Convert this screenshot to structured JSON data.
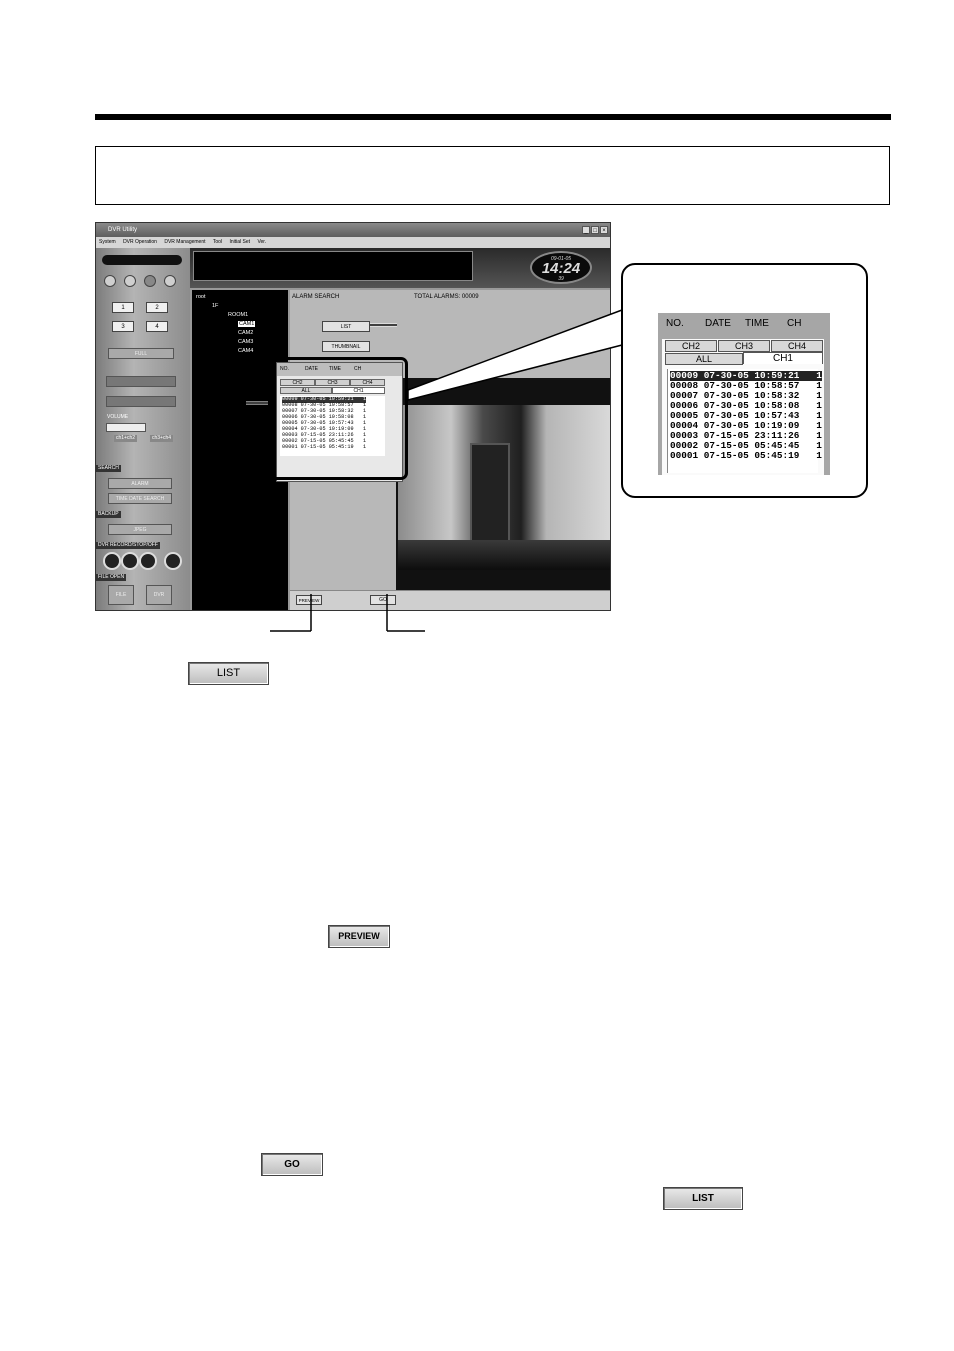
{
  "window": {
    "title": "DVR Utility",
    "controls": [
      "_",
      "□",
      "×"
    ],
    "menu": [
      "System",
      "DVR Operation",
      "DVR Management",
      "Tool",
      "Initial Set",
      "Ver."
    ]
  },
  "left_panel": {
    "number_buttons": [
      "1",
      "2",
      "3",
      "4"
    ],
    "full_label": "FULL",
    "volume_label": "VOLUME",
    "ch_labels": [
      "ch1+ch2",
      "ch3+ch4"
    ],
    "search_label": "SEARCH",
    "alarm_button": "ALARM",
    "time_date_search_button": "TIME DATE SEARCH",
    "backup_label": "BACKUP",
    "jpeg_button": "JPEG",
    "dvr_record_label": "DVR RECORD/STOP/OFF",
    "file_open_label": "FILE OPEN",
    "file_button": "FILE",
    "dvr_button": "DVR"
  },
  "clock": {
    "date": "09-01-05",
    "time": "14:24",
    "seconds": "39"
  },
  "tree": {
    "root": "root",
    "floor": "1F",
    "room": "ROOM1",
    "cams": [
      "CAM1",
      "CAM2",
      "CAM3",
      "CAM4"
    ]
  },
  "main": {
    "alarm_search_label": "ALARM SEARCH",
    "total_alarms": "TOTAL ALARMS: 00009",
    "list_button": "LIST",
    "thumbnail_button": "THUMBNAIL",
    "preview_button": "PREVIEW",
    "go_button": "GO"
  },
  "alarm_list": {
    "columns": [
      "NO.",
      "DATE",
      "TIME",
      "CH"
    ],
    "channel_tabs": [
      "CH2",
      "CH3",
      "CH4"
    ],
    "all_tab": "ALL",
    "ch1_tab": "CH1",
    "rows": [
      "00009 07-30-05 10:59:21   1",
      "00008 07-30-05 10:58:57   1",
      "00007 07-30-05 10:58:32   1",
      "00006 07-30-05 10:58:08   1",
      "00005 07-30-05 10:57:43   1",
      "00004 07-30-05 10:19:09   1",
      "00003 07-15-05 23:11:26   1",
      "00002 07-15-05 05:45:45   1",
      "00001 07-15-05 05:45:19   1"
    ]
  },
  "page_buttons": {
    "list_1": "LIST",
    "preview": "PREVIEW",
    "go": "GO",
    "list_2": "LIST"
  }
}
